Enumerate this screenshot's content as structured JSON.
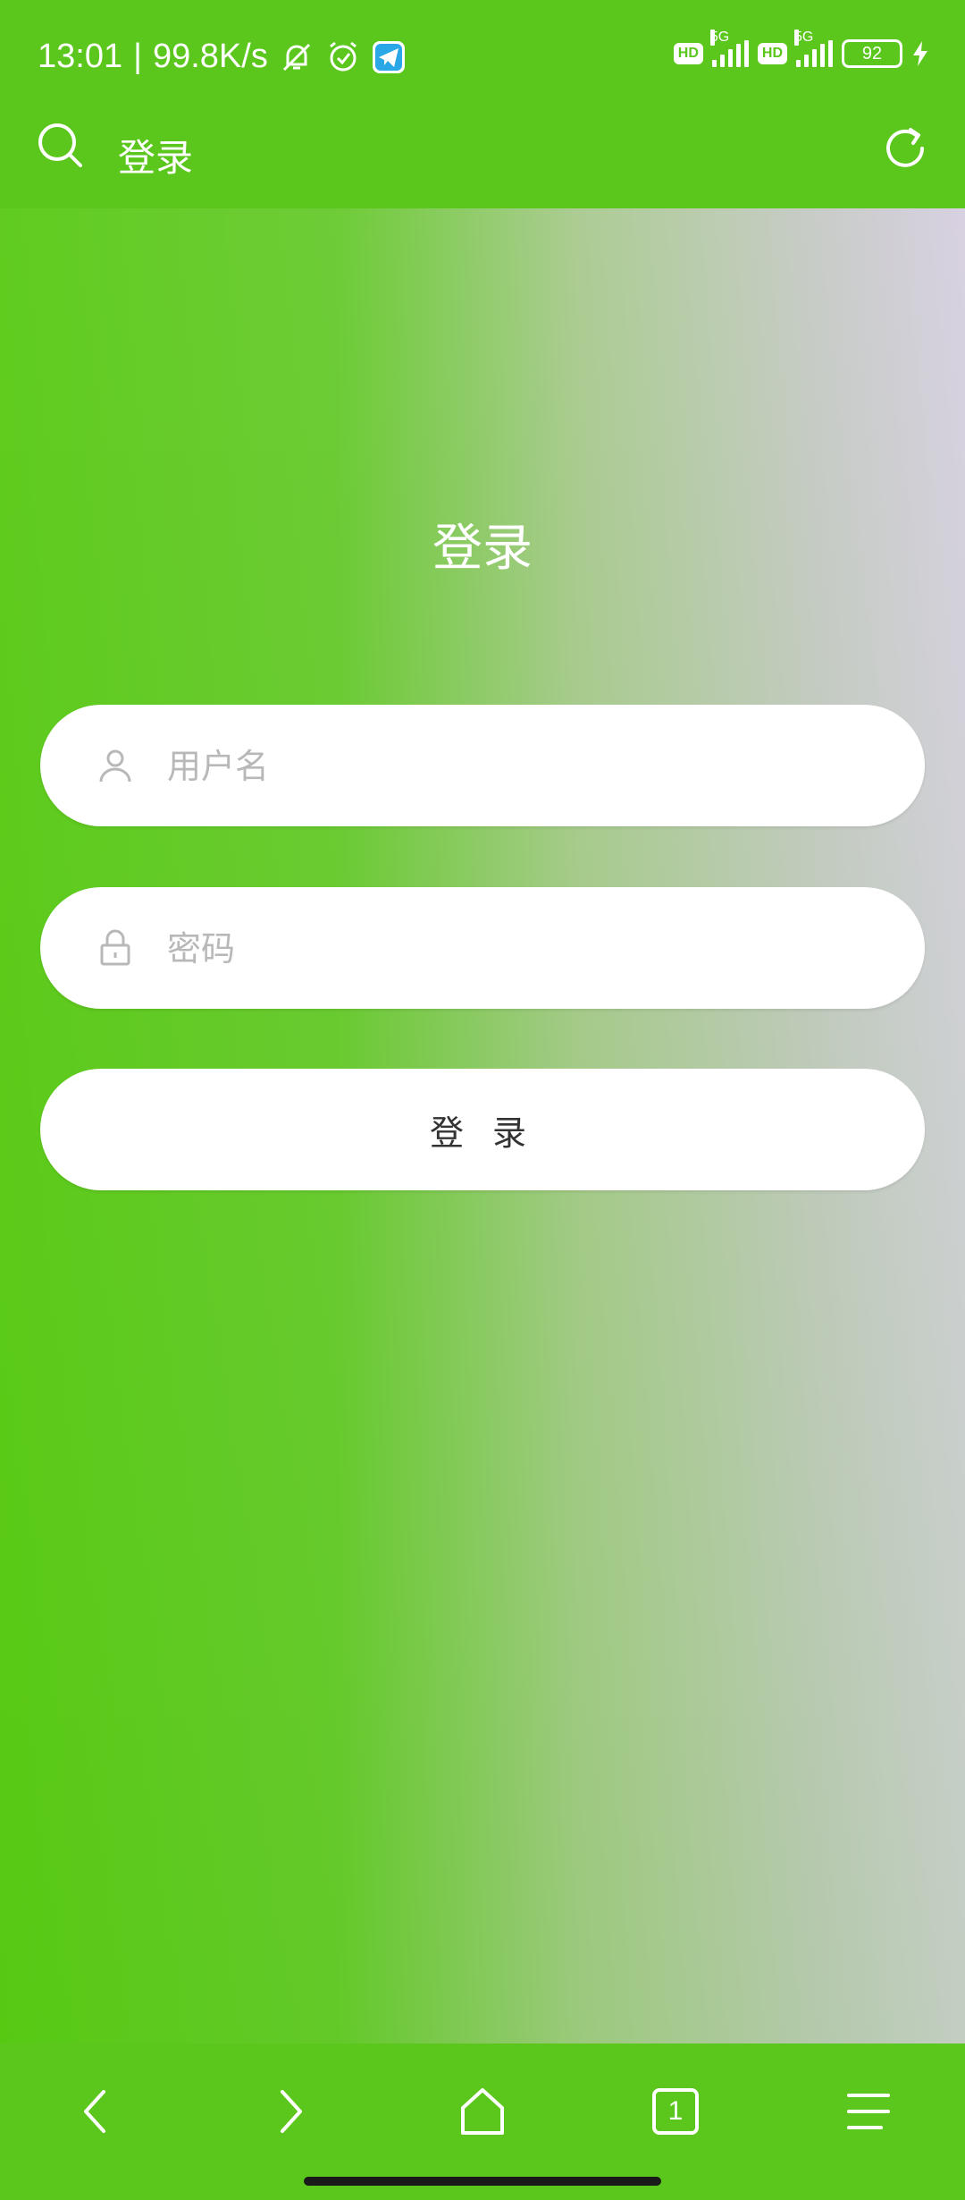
{
  "status_bar": {
    "time": "13:01",
    "separator": "|",
    "net_speed": "99.8K/s",
    "icons": [
      "mute-bell-icon",
      "alarm-icon",
      "telegram-icon"
    ],
    "hd1": "HD",
    "net1": "5G",
    "hd2": "HD",
    "net2": "5G",
    "battery": "92",
    "charging_icon": "bolt-icon"
  },
  "header": {
    "title": "登录",
    "left_icon": "search-icon",
    "right_icon": "refresh-icon"
  },
  "form": {
    "title": "登录",
    "username_placeholder": "用户名",
    "password_placeholder": "密码",
    "submit_label": "登 录"
  },
  "bottom_nav": {
    "tab_count": "1",
    "items": [
      "back-icon",
      "forward-icon",
      "home-icon",
      "tabs-icon",
      "menu-icon"
    ]
  },
  "colors": {
    "primary": "#5bc71c",
    "placeholder": "#b8b8b8"
  }
}
